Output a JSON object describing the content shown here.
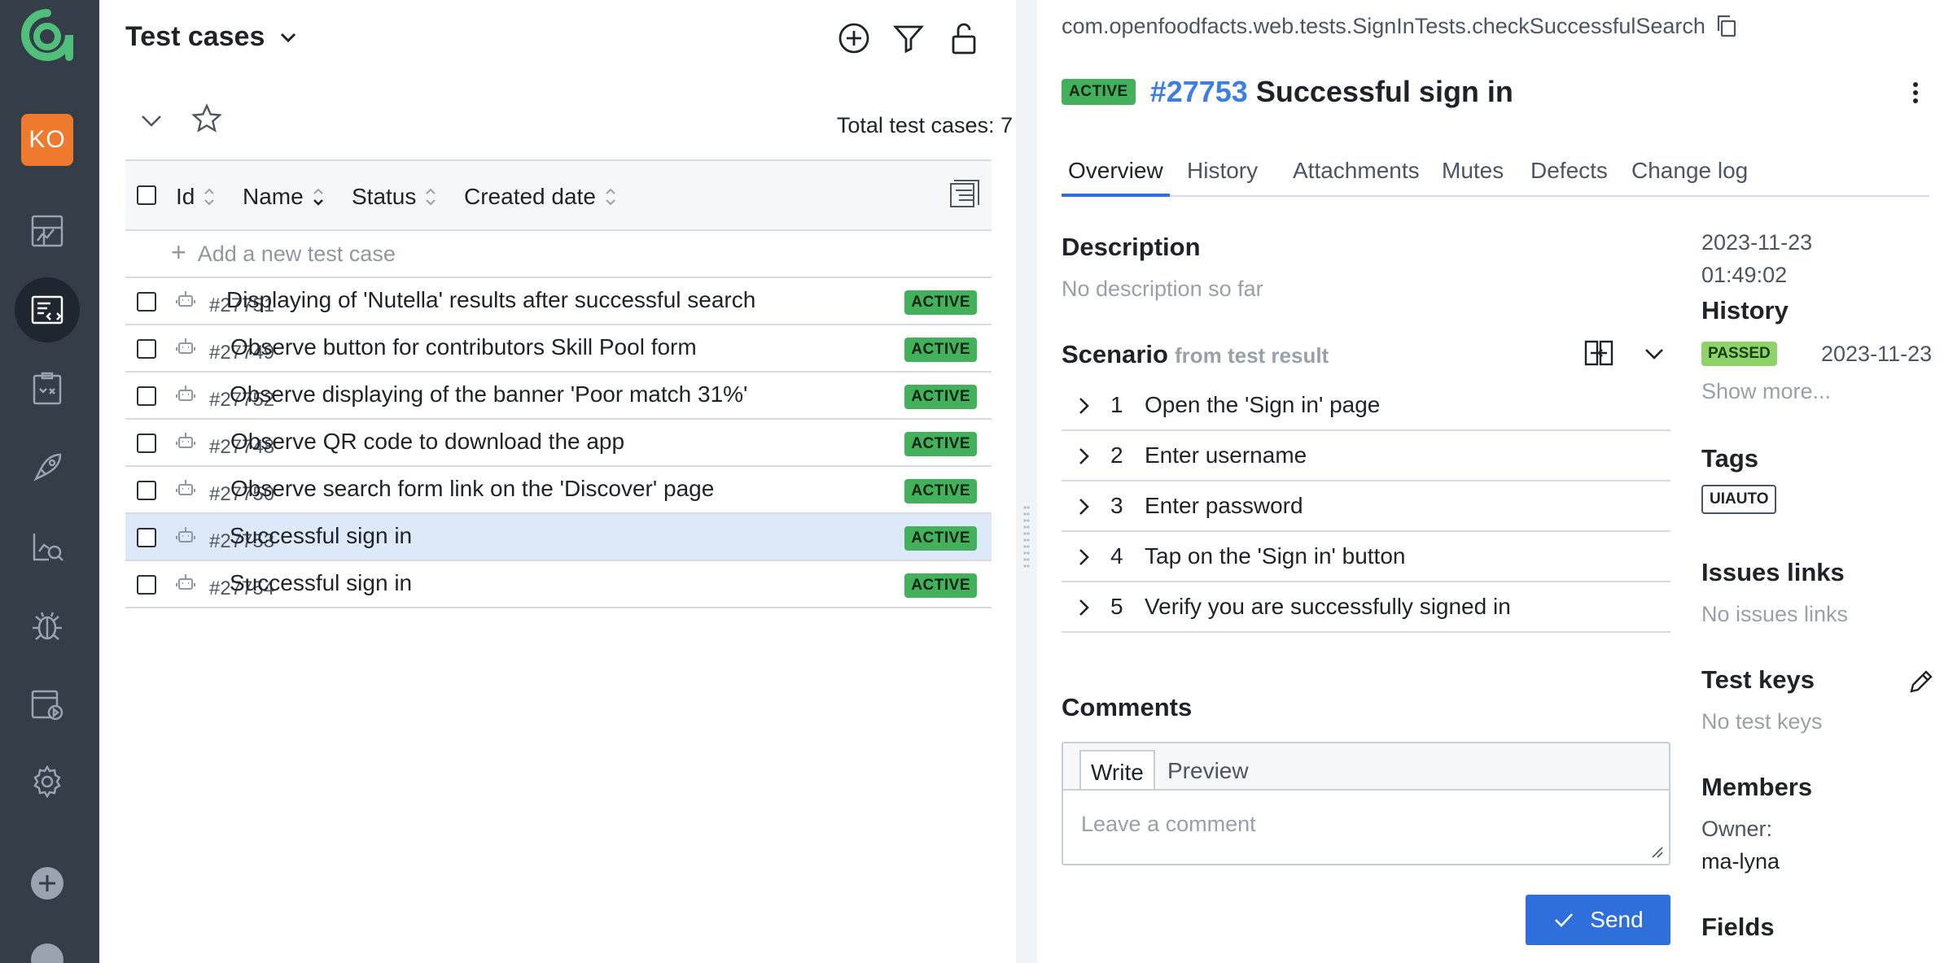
{
  "sidebar": {
    "avatar_initials": "KO",
    "logo_color": "#4fbf7a",
    "items": [
      {
        "name": "dashboards-icon"
      },
      {
        "name": "test-cases-icon",
        "active": true
      },
      {
        "name": "test-plans-icon"
      },
      {
        "name": "launches-icon"
      },
      {
        "name": "analytics-icon"
      },
      {
        "name": "defects-icon"
      },
      {
        "name": "jobs-icon"
      },
      {
        "name": "settings-icon"
      },
      {
        "name": "add-project-icon"
      },
      {
        "name": "help-icon"
      }
    ]
  },
  "list": {
    "title": "Test cases",
    "total_label": "Total test cases: 7",
    "add_label": "Add a new test case",
    "columns": {
      "id": "Id",
      "name": "Name",
      "status": "Status",
      "created": "Created date"
    },
    "rows": [
      {
        "id": "#27751",
        "name": "Displaying of 'Nutella' results after successful search",
        "status": "ACTIVE"
      },
      {
        "id": "#27749",
        "name": "Observe button for contributors Skill Pool form",
        "status": "ACTIVE"
      },
      {
        "id": "#27752",
        "name": "Observe displaying of the banner 'Poor match 31%'",
        "status": "ACTIVE"
      },
      {
        "id": "#27748",
        "name": "Observe QR code to download the app",
        "status": "ACTIVE"
      },
      {
        "id": "#27750",
        "name": "Observe search form link on the 'Discover' page",
        "status": "ACTIVE"
      },
      {
        "id": "#27753",
        "name": "Successful sign in",
        "status": "ACTIVE",
        "selected": true
      },
      {
        "id": "#27754",
        "name": "Successful sign in",
        "status": "ACTIVE"
      }
    ]
  },
  "detail": {
    "full_path": "com.openfoodfacts.web.tests.SignInTests.checkSuccessfulSearch",
    "status": "ACTIVE",
    "id": "#27753",
    "name": "Successful sign in",
    "tabs": [
      "Overview",
      "History",
      "Attachments",
      "Mutes",
      "Defects",
      "Change log"
    ],
    "description_title": "Description",
    "description_empty": "No description so far",
    "scenario_title": "Scenario",
    "scenario_sub": "from test result",
    "steps": [
      {
        "num": "1",
        "text": "Open the 'Sign in' page"
      },
      {
        "num": "2",
        "text": "Enter username"
      },
      {
        "num": "3",
        "text": "Enter password"
      },
      {
        "num": "4",
        "text": "Tap on the 'Sign in' button"
      },
      {
        "num": "5",
        "text": "Verify you are successfully signed in"
      }
    ],
    "comments_title": "Comments",
    "comment_tab_write": "Write",
    "comment_tab_preview": "Preview",
    "comment_placeholder": "Leave a comment",
    "send_label": "Send"
  },
  "meta": {
    "created_date": "2023-11-23",
    "created_time": "01:49:02",
    "history_title": "History",
    "history_status": "PASSED",
    "history_date": "2023-11-23",
    "show_more": "Show more...",
    "tags_title": "Tags",
    "tag": "UIAUTO",
    "issues_title": "Issues links",
    "issues_empty": "No issues links",
    "keys_title": "Test keys",
    "keys_empty": "No test keys",
    "members_title": "Members",
    "owner_label": "Owner:",
    "owner": "ma-lyna",
    "fields_title": "Fields"
  }
}
